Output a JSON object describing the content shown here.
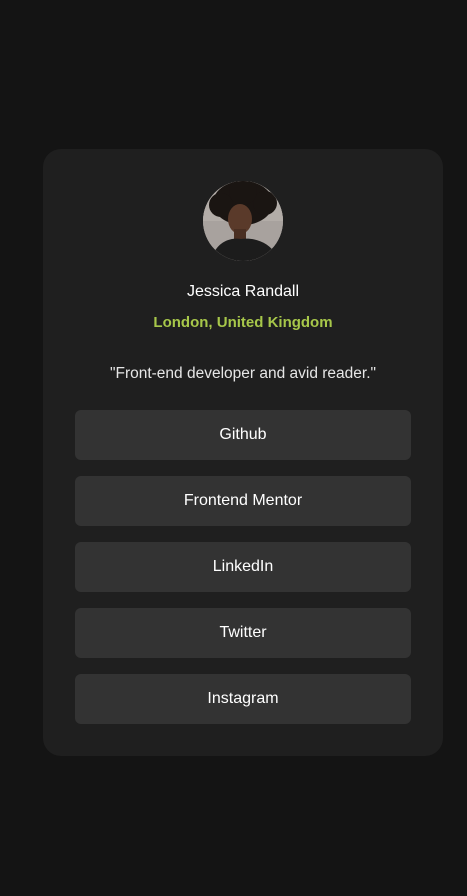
{
  "profile": {
    "name": "Jessica Randall",
    "location": "London, United Kingdom",
    "bio": "\"Front-end developer and avid reader.\""
  },
  "links": [
    {
      "label": "Github"
    },
    {
      "label": "Frontend Mentor"
    },
    {
      "label": "LinkedIn"
    },
    {
      "label": "Twitter"
    },
    {
      "label": "Instagram"
    }
  ],
  "colors": {
    "page_background": "#141414",
    "card_background": "#1f1f1f",
    "button_background": "#333333",
    "accent": "#a7c74a",
    "text": "#ffffff"
  }
}
